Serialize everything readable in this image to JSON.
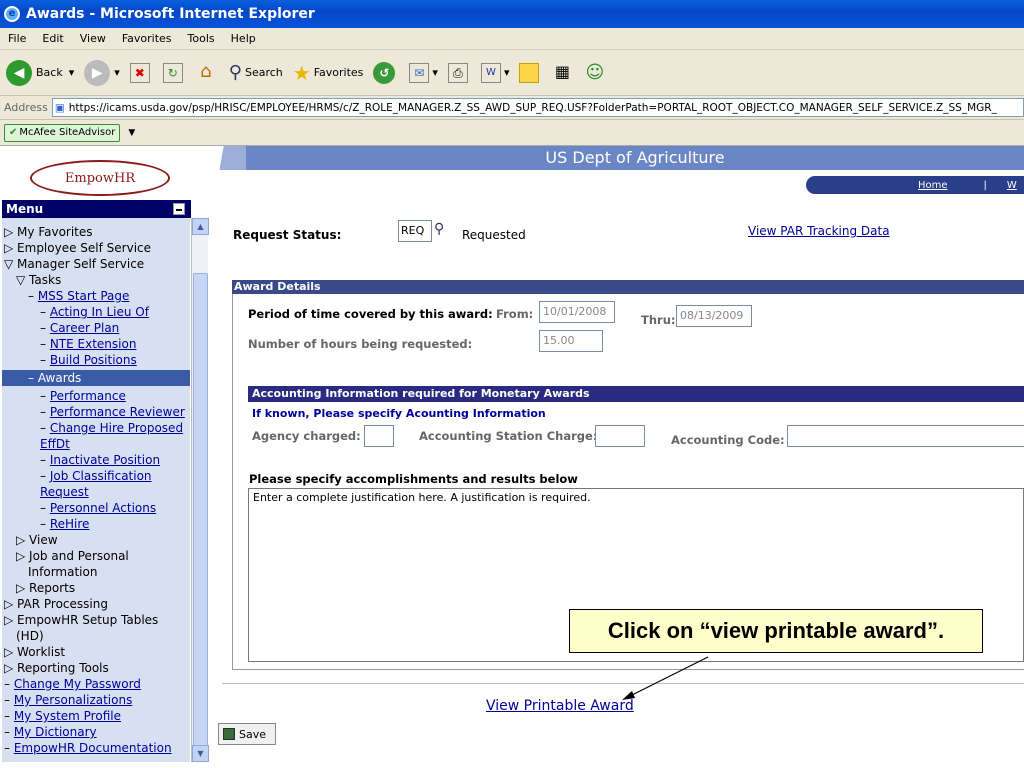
{
  "window": {
    "title": "Awards - Microsoft Internet Explorer"
  },
  "menubar": [
    "File",
    "Edit",
    "View",
    "Favorites",
    "Tools",
    "Help"
  ],
  "toolbar": {
    "back": "Back",
    "search": "Search",
    "favorites": "Favorites"
  },
  "address": {
    "label": "Address",
    "url": "https://icams.usda.gov/psp/HRISC/EMPLOYEE/HRMS/c/Z_ROLE_MANAGER.Z_SS_AWD_SUP_REQ.USF?FolderPath=PORTAL_ROOT_OBJECT.CO_MANAGER_SELF_SERVICE.Z_SS_MGR_"
  },
  "mcafee": {
    "label": "McAfee SiteAdvisor"
  },
  "banner": {
    "title": "US Dept of Agriculture",
    "logo": "EmpowHR",
    "home": "Home",
    "next": "W"
  },
  "menu": {
    "header": "Menu",
    "items": [
      {
        "label": "My Favorites",
        "prefix": "▷ "
      },
      {
        "label": "Employee Self Service",
        "prefix": "▷ "
      },
      {
        "label": "Manager Self Service",
        "prefix": "▽ "
      },
      {
        "label": "Tasks",
        "prefix": "▽ "
      },
      {
        "label": "MSS Start Page",
        "prefix": "– "
      },
      {
        "label": "Acting In Lieu Of",
        "prefix": "– "
      },
      {
        "label": "Career Plan",
        "prefix": "– "
      },
      {
        "label": "NTE Extension",
        "prefix": "– "
      },
      {
        "label": "Build Positions",
        "prefix": "– "
      },
      {
        "label": "Awards",
        "prefix": "– "
      },
      {
        "label": "Performance",
        "prefix": "– "
      },
      {
        "label": "Performance Reviewer",
        "prefix": "– "
      },
      {
        "label": "Change Hire Proposed",
        "prefix": "– "
      },
      {
        "label": "EffDt",
        "prefix": ""
      },
      {
        "label": "Inactivate Position",
        "prefix": "– "
      },
      {
        "label": "Job Classification",
        "prefix": "– "
      },
      {
        "label": "Request",
        "prefix": ""
      },
      {
        "label": "Personnel Actions",
        "prefix": "– "
      },
      {
        "label": "ReHire",
        "prefix": "– "
      },
      {
        "label": "View",
        "prefix": "▷ "
      },
      {
        "label": "Job and Personal",
        "prefix": "▷ "
      },
      {
        "label": "Information",
        "prefix": ""
      },
      {
        "label": "Reports",
        "prefix": "▷ "
      },
      {
        "label": "PAR Processing",
        "prefix": "▷ "
      },
      {
        "label": "EmpowHR Setup Tables",
        "prefix": "▷ "
      },
      {
        "label": "(HD)",
        "prefix": ""
      },
      {
        "label": "Worklist",
        "prefix": "▷ "
      },
      {
        "label": "Reporting Tools",
        "prefix": "▷ "
      },
      {
        "label": "Change My Password",
        "prefix": "– "
      },
      {
        "label": "My Personalizations",
        "prefix": "– "
      },
      {
        "label": "My System Profile",
        "prefix": "– "
      },
      {
        "label": "My Dictionary",
        "prefix": "– "
      },
      {
        "label": "EmpowHR Documentation",
        "prefix": "– "
      }
    ]
  },
  "request": {
    "label": "Request Status:",
    "code": "REQ",
    "status": "Requested",
    "par_link": "View PAR Tracking Data"
  },
  "award": {
    "section": "Award Details",
    "period_label": "Period of time covered by this award:",
    "from_label": "From:",
    "from_value": "10/01/2008",
    "thru_label": "Thru:",
    "thru_value": "08/13/2009",
    "hours_label": "Number of hours being requested:",
    "hours_value": "15.00"
  },
  "accounting": {
    "section": "Accounting Information required for Monetary Awards",
    "note": "If known, Please specify Acounting Information",
    "agency_label": "Agency charged:",
    "station_label": "Accounting Station Charge:",
    "code_label": "Accounting Code:"
  },
  "accomplishments": {
    "label": "Please specify accomplishments and results below",
    "text": "Enter a complete justification here. A justification is required."
  },
  "callout": "Click on “view printable award”.",
  "printable_link": "View Printable Award",
  "save": "Save"
}
